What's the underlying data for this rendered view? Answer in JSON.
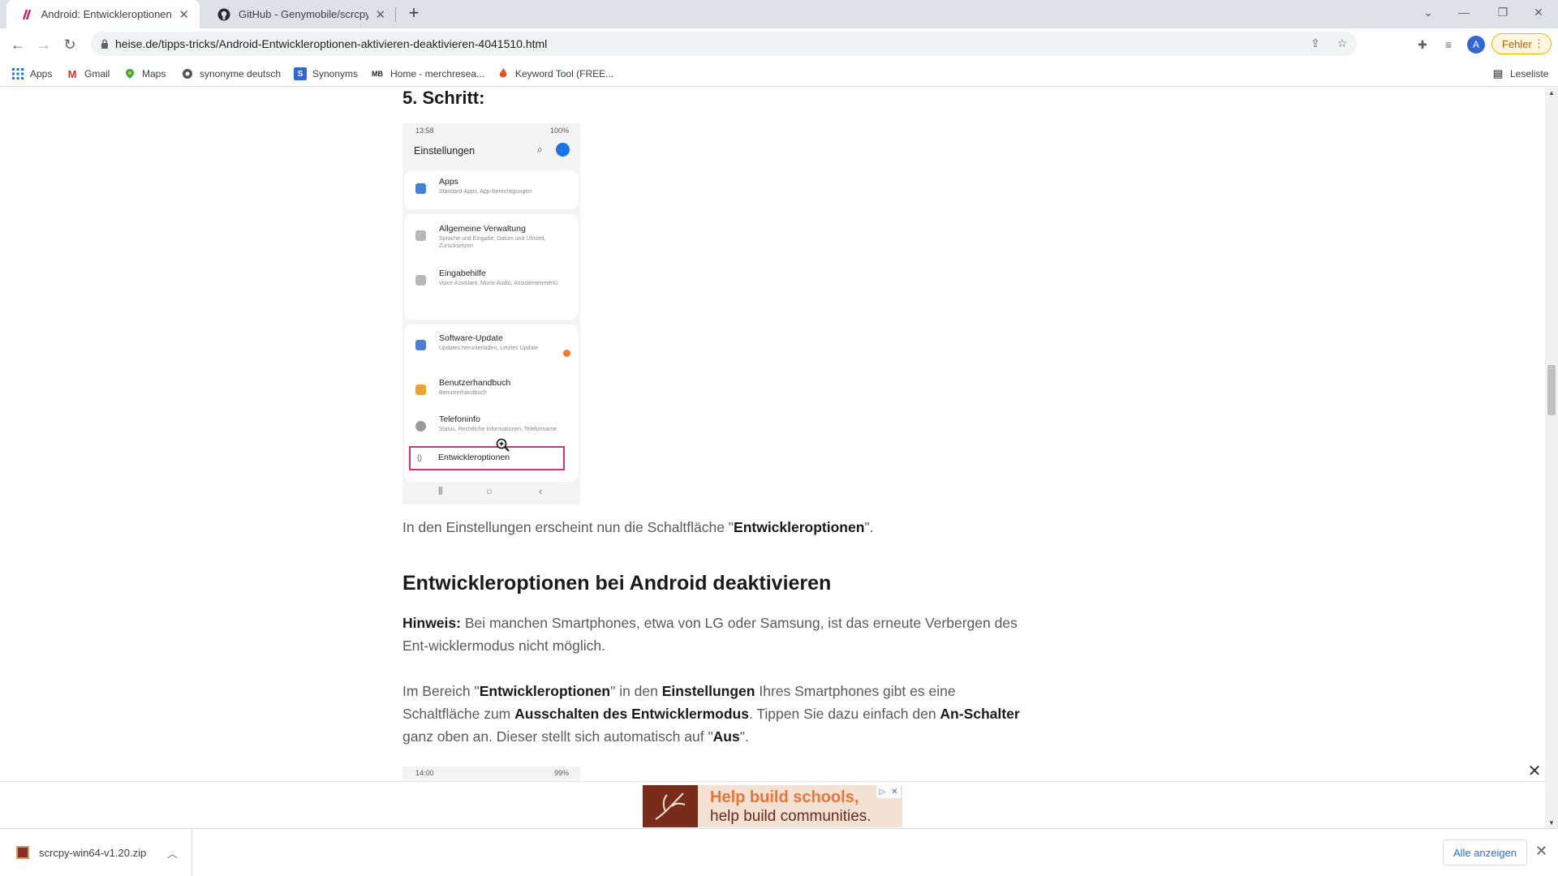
{
  "browser": {
    "tabs": [
      {
        "title": "Android: Entwickleroptionen akti",
        "active": true
      },
      {
        "title": "GitHub - Genymobile/scrcpy: Dis",
        "active": false
      }
    ],
    "url": "heise.de/tipps-tricks/Android-Entwickleroptionen-aktivieren-deaktivieren-4041510.html",
    "profile_initial": "A",
    "error_label": "Fehler",
    "bookmarks": [
      "Apps",
      "Gmail",
      "Maps",
      "synonyme deutsch",
      "Synonyms",
      "Home - merchresea...",
      "Keyword Tool (FREE..."
    ],
    "reading_list": "Leseliste"
  },
  "article": {
    "step_heading": "5. Schritt:",
    "phone": {
      "time": "13:58",
      "status_right": "100%",
      "title": "Einstellungen",
      "items": [
        {
          "title": "Apps",
          "subtitle": "Standard-Apps, App-Berechtigungen"
        },
        {
          "title": "Allgemeine Verwaltung",
          "subtitle": "Sprache und Eingabe, Datum und Uhrzeit, Zurücksetzen"
        },
        {
          "title": "Eingabehilfe",
          "subtitle": "Voice Assistant, Mono-Audio, Assistentenmenü"
        },
        {
          "title": "Software-Update",
          "subtitle": "Updates herunterladen, Letztes Update"
        },
        {
          "title": "Benutzerhandbuch",
          "subtitle": "Benutzerhandbuch"
        },
        {
          "title": "Telefoninfo",
          "subtitle": "Status, Rechtliche Informationen, Telefonname"
        }
      ],
      "highlighted": "Entwickleroptionen"
    },
    "p1_pre": "In den Einstellungen erscheint nun die Schaltfläche \"",
    "p1_bold": "Entwickleroptionen",
    "p1_post": "\".",
    "h2": "Entwickleroptionen bei Android deaktivieren",
    "note_label": "Hinweis:",
    "note_text": " Bei manchen Smartphones, etwa von LG oder Samsung, ist das erneute Verbergen des Ent-wicklermodus nicht möglich.",
    "p3": {
      "t1": "Im Bereich \"",
      "b1": "Entwickleroptionen",
      "t2": "\" in den ",
      "b2": "Einstellungen",
      "t3": " Ihres Smartphones gibt es eine Schaltfläche zum ",
      "b3": "Ausschalten des Entwicklermodus",
      "t4": ". Tippen Sie dazu einfach den ",
      "b4": "An-Schalter",
      "t5": " ganz oben an. Dieser stellt sich automatisch auf \"",
      "b5": "Aus",
      "t6": "\"."
    },
    "phone2": {
      "time": "14:00",
      "status_right": "99%"
    }
  },
  "ad": {
    "line1": "Help build schools,",
    "line2": "help build communities."
  },
  "downloads": {
    "file": "scrcpy-win64-v1.20.zip",
    "show_all": "Alle anzeigen"
  }
}
